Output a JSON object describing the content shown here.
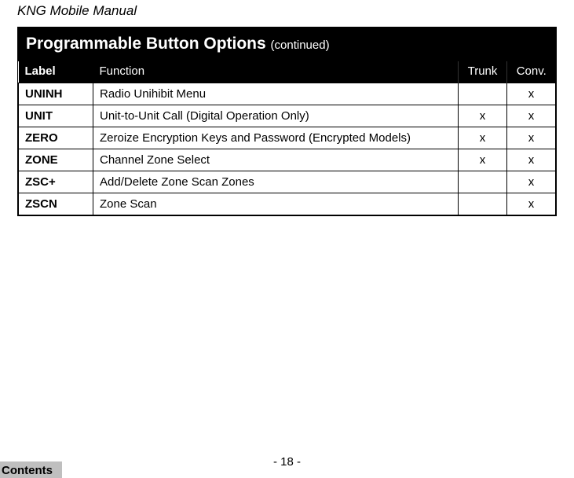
{
  "header": {
    "title": "KNG Mobile Manual"
  },
  "table": {
    "title": "Programmable Button Options",
    "title_suffix": "(continued)",
    "columns": {
      "label": "Label",
      "function": "Function",
      "trunk": "Trunk",
      "conv": "Conv."
    },
    "rows": [
      {
        "label": "UNINH",
        "function": "Radio Unihibit Menu",
        "trunk": "",
        "conv": "x"
      },
      {
        "label": "UNIT",
        "function": "Unit-to-Unit Call (Digital Operation Only)",
        "trunk": "x",
        "conv": "x"
      },
      {
        "label": "ZERO",
        "function": "Zeroize Encryption Keys and Password  (Encrypted Models)",
        "trunk": "x",
        "conv": "x"
      },
      {
        "label": "ZONE",
        "function": "Channel Zone Select",
        "trunk": "x",
        "conv": "x"
      },
      {
        "label": "ZSC+",
        "function": "Add/Delete Zone Scan Zones",
        "trunk": "",
        "conv": "x"
      },
      {
        "label": "ZSCN",
        "function": "Zone Scan",
        "trunk": "",
        "conv": "x"
      }
    ]
  },
  "footer": {
    "page_number": "- 18 -",
    "contents_label": "Contents"
  },
  "chart_data": {
    "type": "table",
    "title": "Programmable Button Options (continued)",
    "columns": [
      "Label",
      "Function",
      "Trunk",
      "Conv."
    ],
    "rows": [
      [
        "UNINH",
        "Radio Unihibit Menu",
        "",
        "x"
      ],
      [
        "UNIT",
        "Unit-to-Unit Call (Digital Operation Only)",
        "x",
        "x"
      ],
      [
        "ZERO",
        "Zeroize Encryption Keys and Password  (Encrypted Models)",
        "x",
        "x"
      ],
      [
        "ZONE",
        "Channel Zone Select",
        "x",
        "x"
      ],
      [
        "ZSC+",
        "Add/Delete Zone Scan Zones",
        "",
        "x"
      ],
      [
        "ZSCN",
        "Zone Scan",
        "",
        "x"
      ]
    ]
  }
}
